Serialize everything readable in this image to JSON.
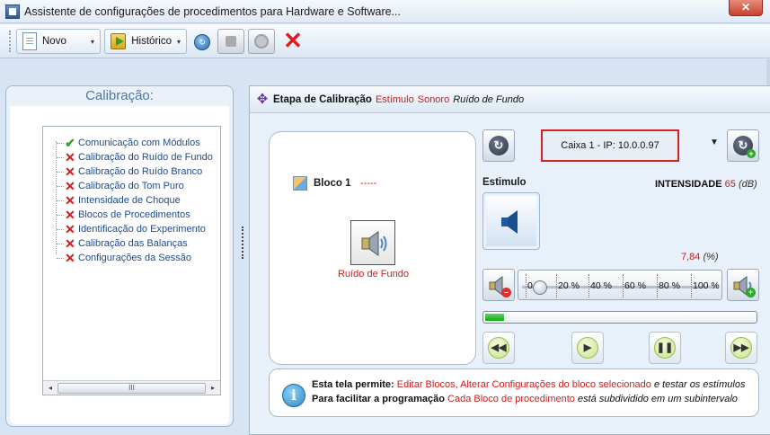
{
  "window": {
    "title": "Assistente de configurações de procedimentos para Hardware e Software...",
    "close_label": "✕"
  },
  "toolbar": {
    "novo_label": "Novo",
    "historico_label": "Histórico",
    "dropdown_glyph": "▾",
    "cancel_glyph": "✕"
  },
  "sidebar": {
    "title": "Calibração:",
    "items": [
      {
        "label": "Comunicação com Módulos",
        "status": "ok",
        "icon": "check-icon"
      },
      {
        "label": "Calibração do Ruído de Fundo",
        "status": "error",
        "icon": "x-icon"
      },
      {
        "label": "Calibração do Ruído Branco",
        "status": "error",
        "icon": "x-icon"
      },
      {
        "label": "Calibração do Tom Puro",
        "status": "error",
        "icon": "x-icon"
      },
      {
        "label": "Intensidade de Choque",
        "status": "error",
        "icon": "x-icon"
      },
      {
        "label": "Blocos de Procedimentos",
        "status": "error",
        "icon": "x-icon"
      },
      {
        "label": "Identificação do Experimento",
        "status": "error",
        "icon": "x-icon"
      },
      {
        "label": "Calibração das Balanças",
        "status": "error",
        "icon": "x-icon"
      },
      {
        "label": "Configurações da Sessão",
        "status": "error",
        "icon": "x-icon"
      }
    ],
    "scroll_left": "◂",
    "scroll_right": "▸",
    "scroll_grip": "III"
  },
  "main": {
    "header": {
      "stage": "Etapa de Calibração",
      "stimulus": "Estímulo",
      "sound": "Sonoro",
      "noise": "Ruído de Fundo"
    },
    "block": {
      "name": "Bloco 1",
      "dashes": "-----",
      "item_label": "Ruído de Fundo"
    },
    "device": {
      "selected": "Caixa 1 - IP: 10.0.0.97",
      "arrow": "▼"
    },
    "stimulus_label": "Estimulo",
    "intensity": {
      "label": "INTENSIDADE",
      "value": "65",
      "unit": "(dB)"
    },
    "percent": {
      "value": "7,84",
      "unit": "(%)"
    },
    "slider": {
      "ticks": [
        "0 %",
        "20 %",
        "40 %",
        "60 %",
        "80 %",
        "100 %"
      ],
      "value_fraction": 0.05
    },
    "progress_fraction": 0.07,
    "playback": [
      {
        "name": "rewind-button",
        "glyph": "◀◀"
      },
      {
        "name": "play-button",
        "glyph": "▶"
      },
      {
        "name": "pause-button",
        "glyph": "❚❚"
      },
      {
        "name": "fast-forward-button",
        "glyph": "▶▶"
      }
    ],
    "info": {
      "line1": {
        "bold": "Esta tela permite:",
        "red": "Editar Blocos, Alterar Configurações do bloco selecionado",
        "italic": "e testar os estímulos"
      },
      "line2": {
        "bold": "Para facilitar a programação",
        "red": "Cada Bloco de procedimento",
        "italic": "está subdividido em um subintervalo"
      }
    }
  },
  "colors": {
    "accent_red": "#d21a1a",
    "check_green": "#2aa52a",
    "link_blue": "#1f4a8a",
    "progress_green": "#16a316"
  }
}
